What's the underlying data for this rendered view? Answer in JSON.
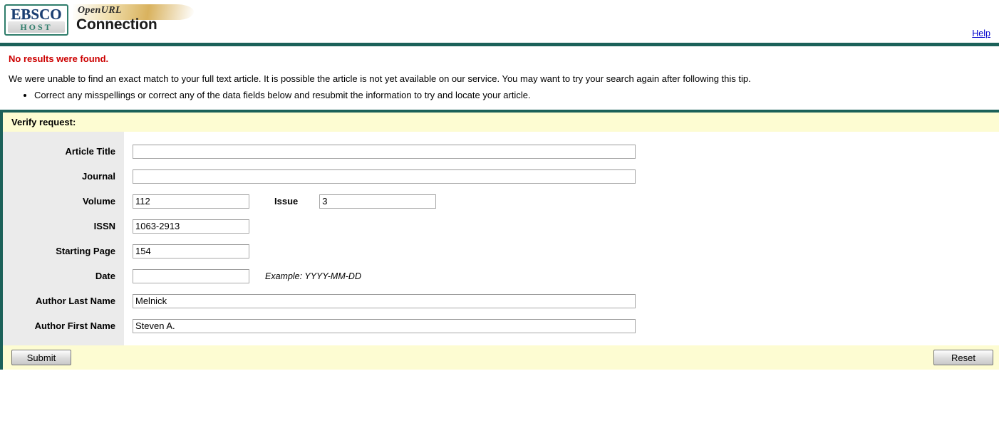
{
  "header": {
    "logo_primary": "EBSCO",
    "logo_secondary": "HOST",
    "product_prefix": "OpenURL",
    "product_name": "Connection",
    "help_label": "Help",
    "rule_color": "#1b6159"
  },
  "messages": {
    "error_title": "No results were found.",
    "error_color": "#cc0000",
    "explanation": "We were unable to find an exact match to your full text article. It is possible the article is not yet available on our service. You may want to try your search again after following this tip.",
    "tips": [
      "Correct any misspellings or correct any of the data fields below and resubmit the information to try and locate your article."
    ]
  },
  "form": {
    "title": "Verify request:",
    "title_bg": "#fdfcd2",
    "fields": {
      "article_title": {
        "label": "Article Title",
        "value": "",
        "placeholder": ""
      },
      "journal": {
        "label": "Journal",
        "value": "",
        "placeholder": ""
      },
      "volume": {
        "label": "Volume",
        "value": "112",
        "placeholder": ""
      },
      "issue": {
        "label": "Issue",
        "value": "3",
        "placeholder": ""
      },
      "issn": {
        "label": "ISSN",
        "value": "1063-2913",
        "placeholder": ""
      },
      "starting_page": {
        "label": "Starting Page",
        "value": "154",
        "placeholder": ""
      },
      "date": {
        "label": "Date",
        "value": "",
        "placeholder": "",
        "hint": "Example: YYYY-MM-DD"
      },
      "author_last_name": {
        "label": "Author Last Name",
        "value": "Melnick",
        "placeholder": ""
      },
      "author_first_name": {
        "label": "Author First Name",
        "value": "Steven A.",
        "placeholder": ""
      }
    },
    "buttons": {
      "submit_label": "Submit",
      "reset_label": "Reset"
    }
  }
}
